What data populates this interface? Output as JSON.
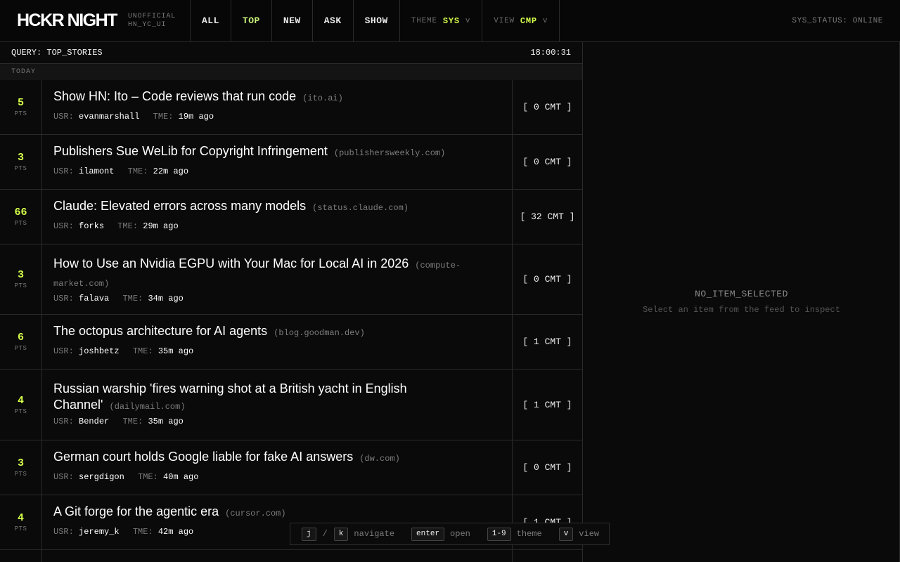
{
  "header": {
    "logo": "HCKR NIGHT",
    "subtitle_line1": "UNOFFICIAL",
    "subtitle_line2": "HN_YC_UI",
    "nav": [
      {
        "label": "ALL"
      },
      {
        "label": "TOP"
      },
      {
        "label": "NEW"
      },
      {
        "label": "ASK"
      },
      {
        "label": "SHOW"
      }
    ],
    "theme_label": "THEME",
    "theme_value": "SYS",
    "view_label": "VIEW",
    "view_value": "CMP",
    "chevron": "v",
    "sys_status": "SYS_STATUS: ONLINE"
  },
  "feed": {
    "query": "QUERY: TOP_STORIES",
    "clock": "18:00:31",
    "section": "TODAY",
    "pts_label": "PTS",
    "usr_label": "USR:",
    "tme_label": "TME:",
    "stories": [
      {
        "points": "5",
        "title": "Show HN: Ito – Code reviews that run code",
        "domain": "(ito.ai)",
        "user": "evanmarshall",
        "time": "19m ago",
        "comments": "[ 0 CMT ]"
      },
      {
        "points": "3",
        "title": "Publishers Sue WeLib for Copyright Infringement",
        "domain": "(publishersweekly.com)",
        "user": "ilamont",
        "time": "22m ago",
        "comments": "[ 0 CMT ]"
      },
      {
        "points": "66",
        "title": "Claude: Elevated errors across many models",
        "domain": "(status.claude.com)",
        "user": "forks",
        "time": "29m ago",
        "comments": "[ 32 CMT ]"
      },
      {
        "points": "3",
        "title": "How to Use an Nvidia EGPU with Your Mac for Local AI in 2026",
        "domain": "(compute-market.com)",
        "user": "falava",
        "time": "34m ago",
        "comments": "[ 0 CMT ]"
      },
      {
        "points": "6",
        "title": "The octopus architecture for AI agents",
        "domain": "(blog.goodman.dev)",
        "user": "joshbetz",
        "time": "35m ago",
        "comments": "[ 1 CMT ]"
      },
      {
        "points": "4",
        "title": "Russian warship 'fires warning shot at a British yacht in English Channel'",
        "domain": "(dailymail.com)",
        "user": "Bender",
        "time": "35m ago",
        "comments": "[ 1 CMT ]"
      },
      {
        "points": "3",
        "title": "German court holds Google liable for fake AI answers",
        "domain": "(dw.com)",
        "user": "sergdigon",
        "time": "40m ago",
        "comments": "[ 0 CMT ]"
      },
      {
        "points": "4",
        "title": "A Git forge for the agentic era",
        "domain": "(cursor.com)",
        "user": "jeremy_k",
        "time": "42m ago",
        "comments": "[ 1 CMT ]"
      }
    ]
  },
  "inspector": {
    "empty_title": "NO_ITEM_SELECTED",
    "empty_subtitle": "Select an item from the feed to inspect"
  },
  "shortcuts": {
    "key_j": "j",
    "separator": "/",
    "key_k": "k",
    "navigate": "navigate",
    "key_enter": "enter",
    "open": "open",
    "key_theme": "1-9",
    "theme": "theme",
    "key_view": "v",
    "view": "view"
  },
  "colors": {
    "accent": "#d6ff4a",
    "active_nav": "#c9f27a",
    "background": "#0a0a0a",
    "border": "#2a2a2a"
  }
}
